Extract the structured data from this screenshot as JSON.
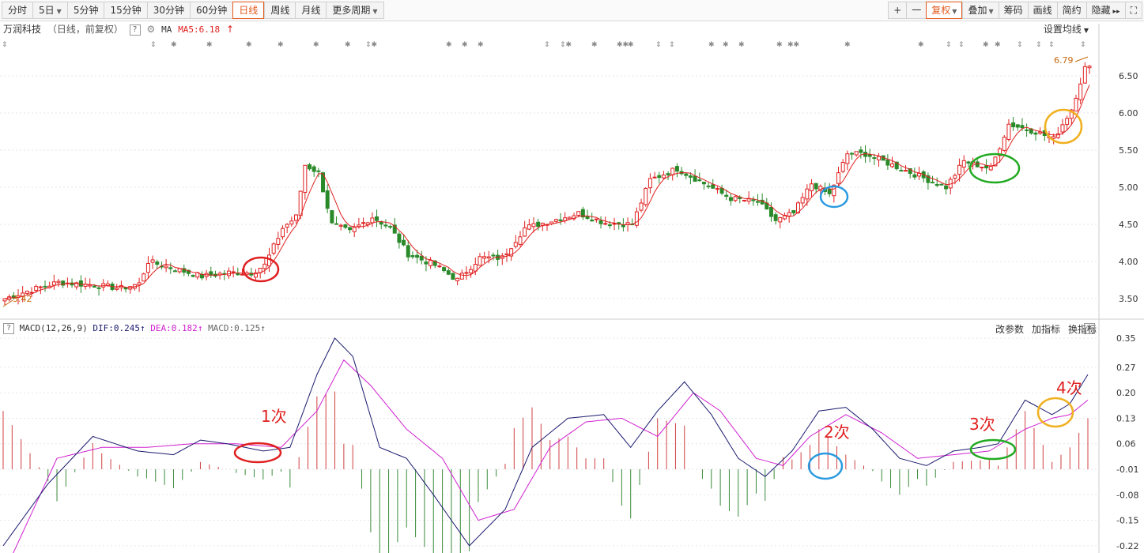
{
  "toolbar": {
    "periods": [
      "分时",
      "5日",
      "5分钟",
      "15分钟",
      "30分钟",
      "60分钟",
      "日线",
      "周线",
      "月线",
      "更多周期"
    ],
    "active_period": "日线",
    "right_items": [
      "+",
      "一",
      "复权",
      "叠加",
      "筹码",
      "画线",
      "简约",
      "隐藏"
    ]
  },
  "info": {
    "stock_name": "万润科技",
    "mode": "（日线，前复权）",
    "ma_label": "MA",
    "ma5_label": "MA5:6.18",
    "set_ma": "设置均线"
  },
  "price_axis": {
    "ticks": [
      "6.50",
      "6.00",
      "5.50",
      "5.00",
      "4.50",
      "4.00",
      "3.50"
    ]
  },
  "price_annotations": {
    "high": "6.79",
    "low": "3.42"
  },
  "macd_header": {
    "title": "MACD(12,26,9)",
    "dif": "DIF:0.245",
    "dea": "DEA:0.182",
    "macd": "MACD:0.125",
    "tools": [
      "改参数",
      "加指标",
      "换指标"
    ]
  },
  "macd_axis": {
    "ticks": [
      "0.35",
      "0.27",
      "0.20",
      "0.13",
      "0.06",
      "-0.01",
      "-0.08",
      "-0.15",
      "-0.22"
    ]
  },
  "annotations": [
    {
      "label": "1次",
      "color": "#e02020"
    },
    {
      "label": "2次",
      "color": "#e02020"
    },
    {
      "label": "3次",
      "color": "#e02020"
    },
    {
      "label": "4次",
      "color": "#e02020"
    }
  ],
  "colors": {
    "up": "#e02020",
    "down": "#2a8a2a",
    "ma5": "#e02020",
    "dif": "#1a1a6e",
    "dea": "#d020d0",
    "circle_red": "#e02020",
    "circle_blue": "#2a9ae0",
    "circle_green": "#22aa22",
    "circle_yellow": "#f0b020"
  }
}
